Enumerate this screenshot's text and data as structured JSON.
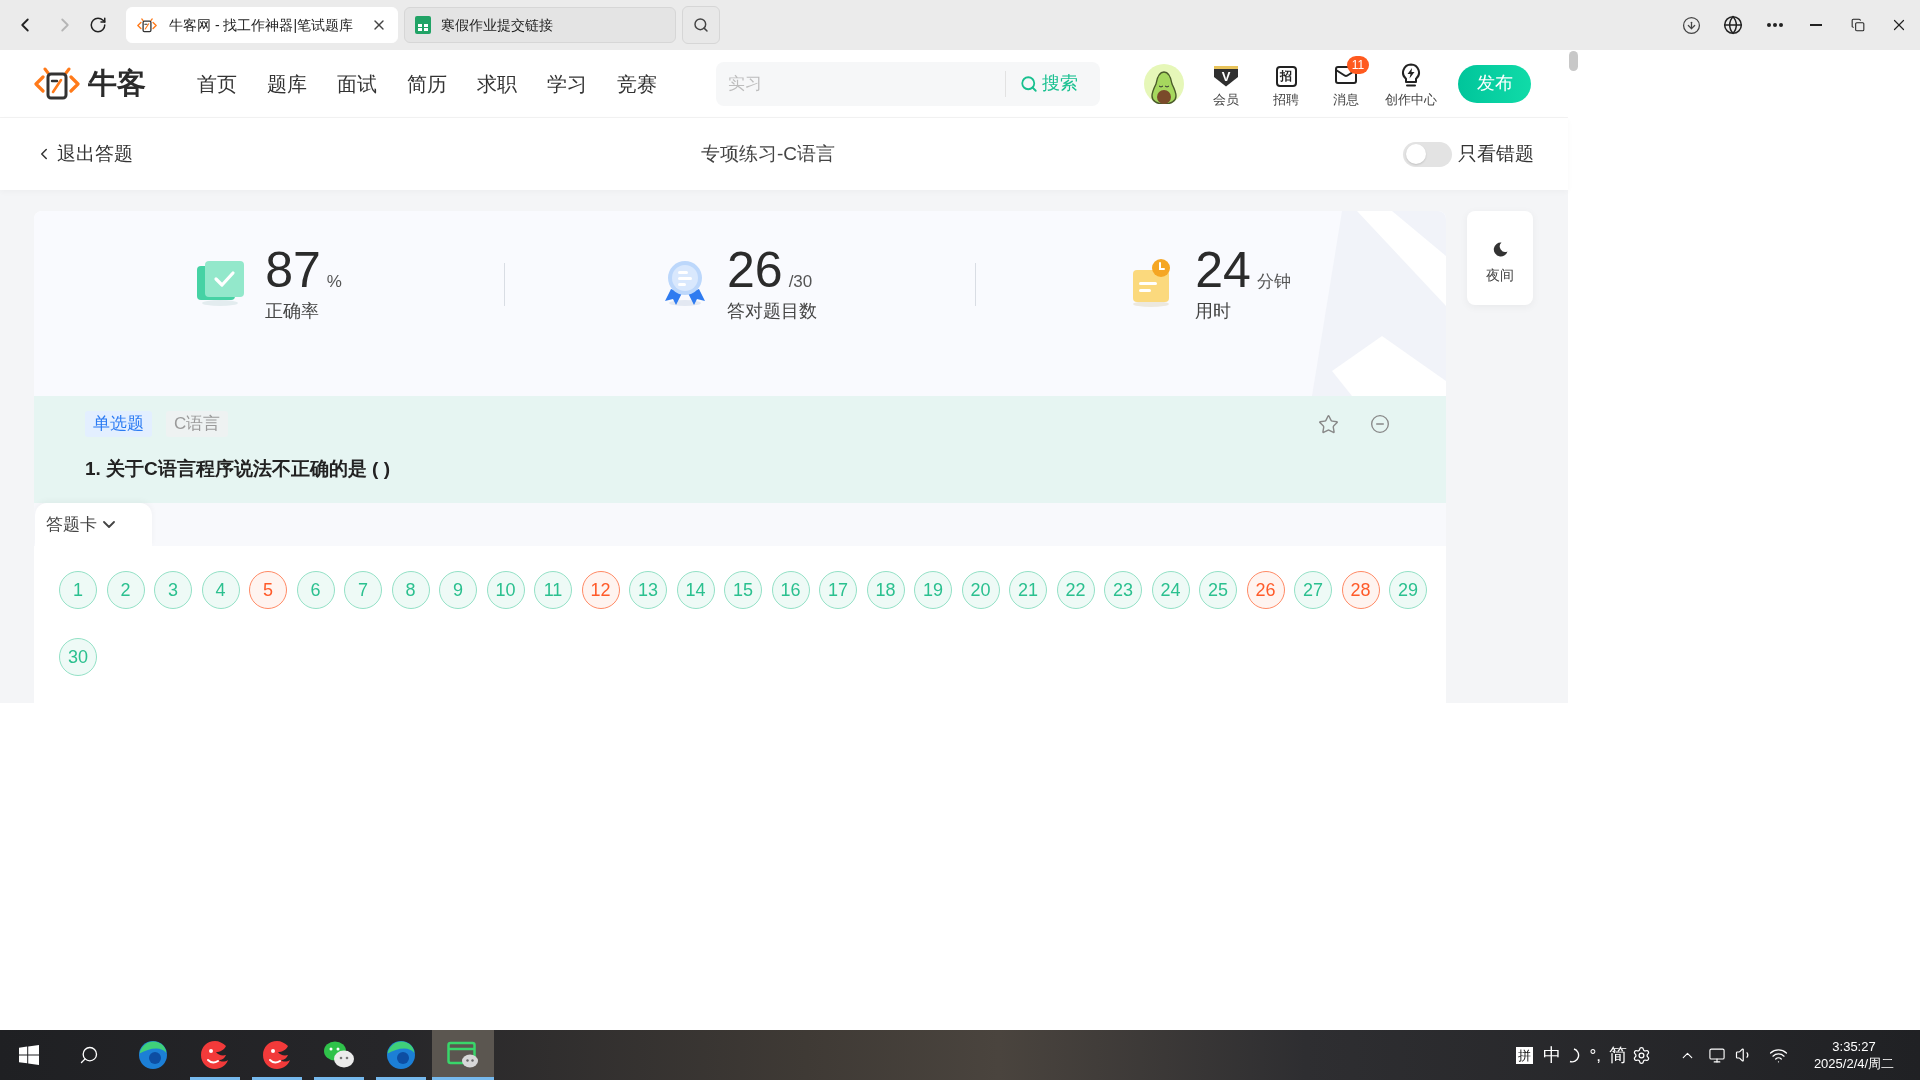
{
  "browser": {
    "tabs": [
      {
        "title": "牛客网 - 找工作神器|笔试题库",
        "selected": true
      },
      {
        "title": "寒假作业提交链接",
        "selected": false
      }
    ]
  },
  "site_header": {
    "logo_text": "牛客",
    "nav": [
      "首页",
      "题库",
      "面试",
      "简历",
      "求职",
      "学习",
      "竞赛"
    ],
    "search": {
      "placeholder": "实习",
      "button": "搜索"
    },
    "links": [
      {
        "label": "会员",
        "glyph": "V"
      },
      {
        "label": "招聘",
        "glyph": "招"
      },
      {
        "label": "消息",
        "badge": "11"
      },
      {
        "label": "创作中心"
      }
    ],
    "publish_button": "发布"
  },
  "subheader": {
    "back": "退出答题",
    "title": "专项练习-C语言",
    "filter_toggle": {
      "label": "只看错题",
      "on": false
    }
  },
  "stats": [
    {
      "value": "87",
      "unit": "%",
      "label": "正确率"
    },
    {
      "value": "26",
      "unit": "/30",
      "label": "答对题目数"
    },
    {
      "value": "24",
      "unit": "分钟",
      "label": "用时"
    }
  ],
  "night_mode": {
    "label": "夜间"
  },
  "question": {
    "tags": [
      {
        "kind": "type",
        "label": "单选题"
      },
      {
        "kind": "topic",
        "label": "C语言"
      }
    ],
    "text": "1. 关于C语言程序说法不正确的是 ( )"
  },
  "answer_card": {
    "label": "答题卡",
    "expanded": true,
    "items": [
      {
        "number": "1",
        "correct": true
      },
      {
        "number": "2",
        "correct": true
      },
      {
        "number": "3",
        "correct": true
      },
      {
        "number": "4",
        "correct": true
      },
      {
        "number": "5",
        "correct": false
      },
      {
        "number": "6",
        "correct": true
      },
      {
        "number": "7",
        "correct": true
      },
      {
        "number": "8",
        "correct": true
      },
      {
        "number": "9",
        "correct": true
      },
      {
        "number": "10",
        "correct": true
      },
      {
        "number": "11",
        "correct": true
      },
      {
        "number": "12",
        "correct": false
      },
      {
        "number": "13",
        "correct": true
      },
      {
        "number": "14",
        "correct": true
      },
      {
        "number": "15",
        "correct": true
      },
      {
        "number": "16",
        "correct": true
      },
      {
        "number": "17",
        "correct": true
      },
      {
        "number": "18",
        "correct": true
      },
      {
        "number": "19",
        "correct": true
      },
      {
        "number": "20",
        "correct": true
      },
      {
        "number": "21",
        "correct": true
      },
      {
        "number": "22",
        "correct": true
      },
      {
        "number": "23",
        "correct": true
      },
      {
        "number": "24",
        "correct": true
      },
      {
        "number": "25",
        "correct": true
      },
      {
        "number": "26",
        "correct": false
      },
      {
        "number": "27",
        "correct": true
      },
      {
        "number": "28",
        "correct": false
      },
      {
        "number": "29",
        "correct": true
      },
      {
        "number": "30",
        "correct": true
      }
    ]
  },
  "taskbar": {
    "apps": [
      {
        "running": false,
        "active": false
      },
      {
        "running": true,
        "active": false
      },
      {
        "running": true,
        "active": false
      },
      {
        "running": true,
        "active": false
      },
      {
        "running": true,
        "active": false
      },
      {
        "running": true,
        "active": true
      }
    ],
    "ime": {
      "mode": "拼",
      "language": "中",
      "punctuation": "°,",
      "script": "简"
    },
    "time": "3:35:27",
    "date": "2025/2/4/周二"
  }
}
